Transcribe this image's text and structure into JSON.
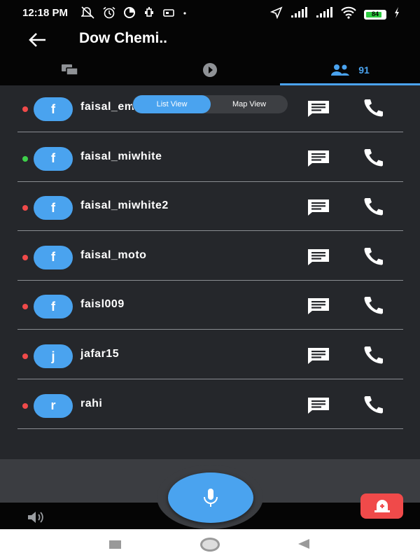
{
  "status_bar": {
    "time": "12:18 PM",
    "battery": "84",
    "icons": [
      "mute-icon",
      "alarm-icon",
      "data-saver-icon",
      "usb-icon",
      "notification-icon",
      "location-icon",
      "signal-icon",
      "signal-icon",
      "wifi-icon",
      "battery-icon",
      "charging-icon"
    ]
  },
  "app_bar": {
    "title": "Dow Chemi.."
  },
  "tabs": [
    {
      "name": "chat",
      "icon": "chat-bubbles-icon",
      "label": ""
    },
    {
      "name": "play",
      "icon": "play-icon",
      "label": ""
    },
    {
      "name": "members",
      "icon": "people-icon",
      "label": "91",
      "active": true
    }
  ],
  "view_toggle": {
    "list": "List View",
    "map": "Map View",
    "selected": "List View"
  },
  "contacts": [
    {
      "initial": "f",
      "name": "faisal_emu_12",
      "status": "offline"
    },
    {
      "initial": "f",
      "name": "faisal_miwhite",
      "status": "online"
    },
    {
      "initial": "f",
      "name": "faisal_miwhite2",
      "status": "offline"
    },
    {
      "initial": "f",
      "name": "faisal_moto",
      "status": "offline"
    },
    {
      "initial": "f",
      "name": "faisl009",
      "status": "offline"
    },
    {
      "initial": "j",
      "name": "jafar15",
      "status": "offline"
    },
    {
      "initial": "r",
      "name": "rahi",
      "status": "offline"
    }
  ],
  "colors": {
    "accent": "#4aa3ef",
    "online": "#3ecf4a",
    "offline": "#f04a4a",
    "alert": "#f04a4a",
    "list_background": "#25272b"
  },
  "bottom": {
    "speaker_icon": "speaker-icon",
    "mic_icon": "microphone-icon",
    "alert_icon": "alarm-bell-icon"
  },
  "nav": {
    "icons": [
      "recents-icon",
      "home-icon",
      "back-icon"
    ]
  }
}
